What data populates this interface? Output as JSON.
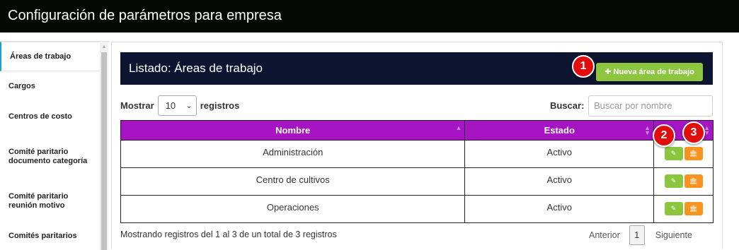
{
  "app": {
    "title": "Configuración de parámetros para empresa"
  },
  "sidebar": {
    "items": [
      {
        "label": "Áreas de trabajo",
        "active": true
      },
      {
        "label": "Cargos",
        "active": false
      },
      {
        "label": "Centros de costo",
        "active": false
      },
      {
        "label": "Comité paritario documento categoría",
        "active": false
      },
      {
        "label": "Comité paritario reunión motivo",
        "active": false
      },
      {
        "label": "Comités paritarios",
        "active": false
      }
    ]
  },
  "list": {
    "title": "Listado: Áreas de trabajo",
    "new_button_label": "Nueva área de trabajo"
  },
  "badges": [
    "1",
    "2",
    "3"
  ],
  "table_controls": {
    "show_label": "Mostrar",
    "page_length": "10",
    "records_label": "registros",
    "search_label": "Buscar:",
    "search_placeholder": "Buscar por nombre"
  },
  "table": {
    "columns": [
      "Nombre",
      "Estado",
      ""
    ],
    "rows": [
      {
        "nombre": "Administración",
        "estado": "Activo"
      },
      {
        "nombre": "Centro de cultivos",
        "estado": "Activo"
      },
      {
        "nombre": "Operaciones",
        "estado": "Activo"
      }
    ]
  },
  "footer": {
    "info": "Mostrando registros del 1 al 3 de un total de 3 registros",
    "prev_label": "Anterior",
    "current_page": "1",
    "next_label": "Siguiente"
  },
  "colors": {
    "topbar": "#020a02",
    "list_header": "#0d1530",
    "table_header": "#a714c4",
    "success_button": "#8cc63f",
    "warning_button": "#f7931e",
    "badge": "#e10d0d"
  },
  "icons": {
    "plus": "plus-icon",
    "edit": "pencil-icon",
    "delete": "bank-icon",
    "sort": "sort-icon",
    "select_caret": "chevron-down-icon",
    "scroll_up": "arrow-up-icon"
  }
}
